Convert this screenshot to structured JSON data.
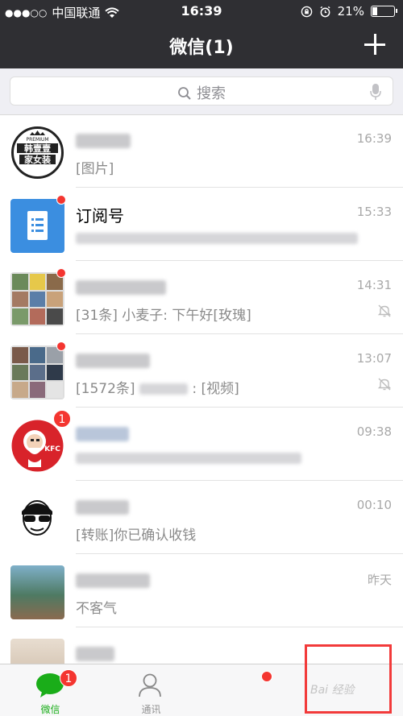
{
  "status_bar": {
    "signal_dots": "●●●○○",
    "carrier": "中国联通",
    "time": "16:39",
    "battery": "21%",
    "battery_level": 0.21
  },
  "nav": {
    "title": "微信(1)"
  },
  "search": {
    "placeholder": "搜索"
  },
  "chats": [
    {
      "title": "",
      "subtitle": "[图片]",
      "time": "16:39",
      "avatar_text_top": "PREMIUM",
      "avatar_text_1": "韩壹壹",
      "avatar_text_2": "家女装"
    },
    {
      "title": "订阅号",
      "subtitle": "",
      "time": "15:33"
    },
    {
      "title": "",
      "subtitle": "[31条] 小麦子: 下午好[玫瑰]",
      "time": "14:31"
    },
    {
      "title": "",
      "subtitle_prefix": "[1572条]",
      "subtitle_suffix": ": [视频]",
      "time": "13:07"
    },
    {
      "title": "",
      "subtitle": "",
      "time": "09:38",
      "badge": "1",
      "avatar_text": "KFC"
    },
    {
      "title": "",
      "subtitle": "[转账]你已确认收钱",
      "time": "00:10"
    },
    {
      "title": "",
      "subtitle": "不客气",
      "time": "昨天"
    },
    {
      "title": "",
      "subtitle": "",
      "time": ""
    }
  ],
  "tabs": [
    {
      "label": "微信",
      "badge": "1"
    },
    {
      "label": "通讯"
    },
    {
      "label": ""
    },
    {
      "label": ""
    }
  ],
  "watermark": "Bai 经验",
  "colors": {
    "bar": "#2f2f33",
    "accent": "#1aad19",
    "badge": "#f43530"
  }
}
